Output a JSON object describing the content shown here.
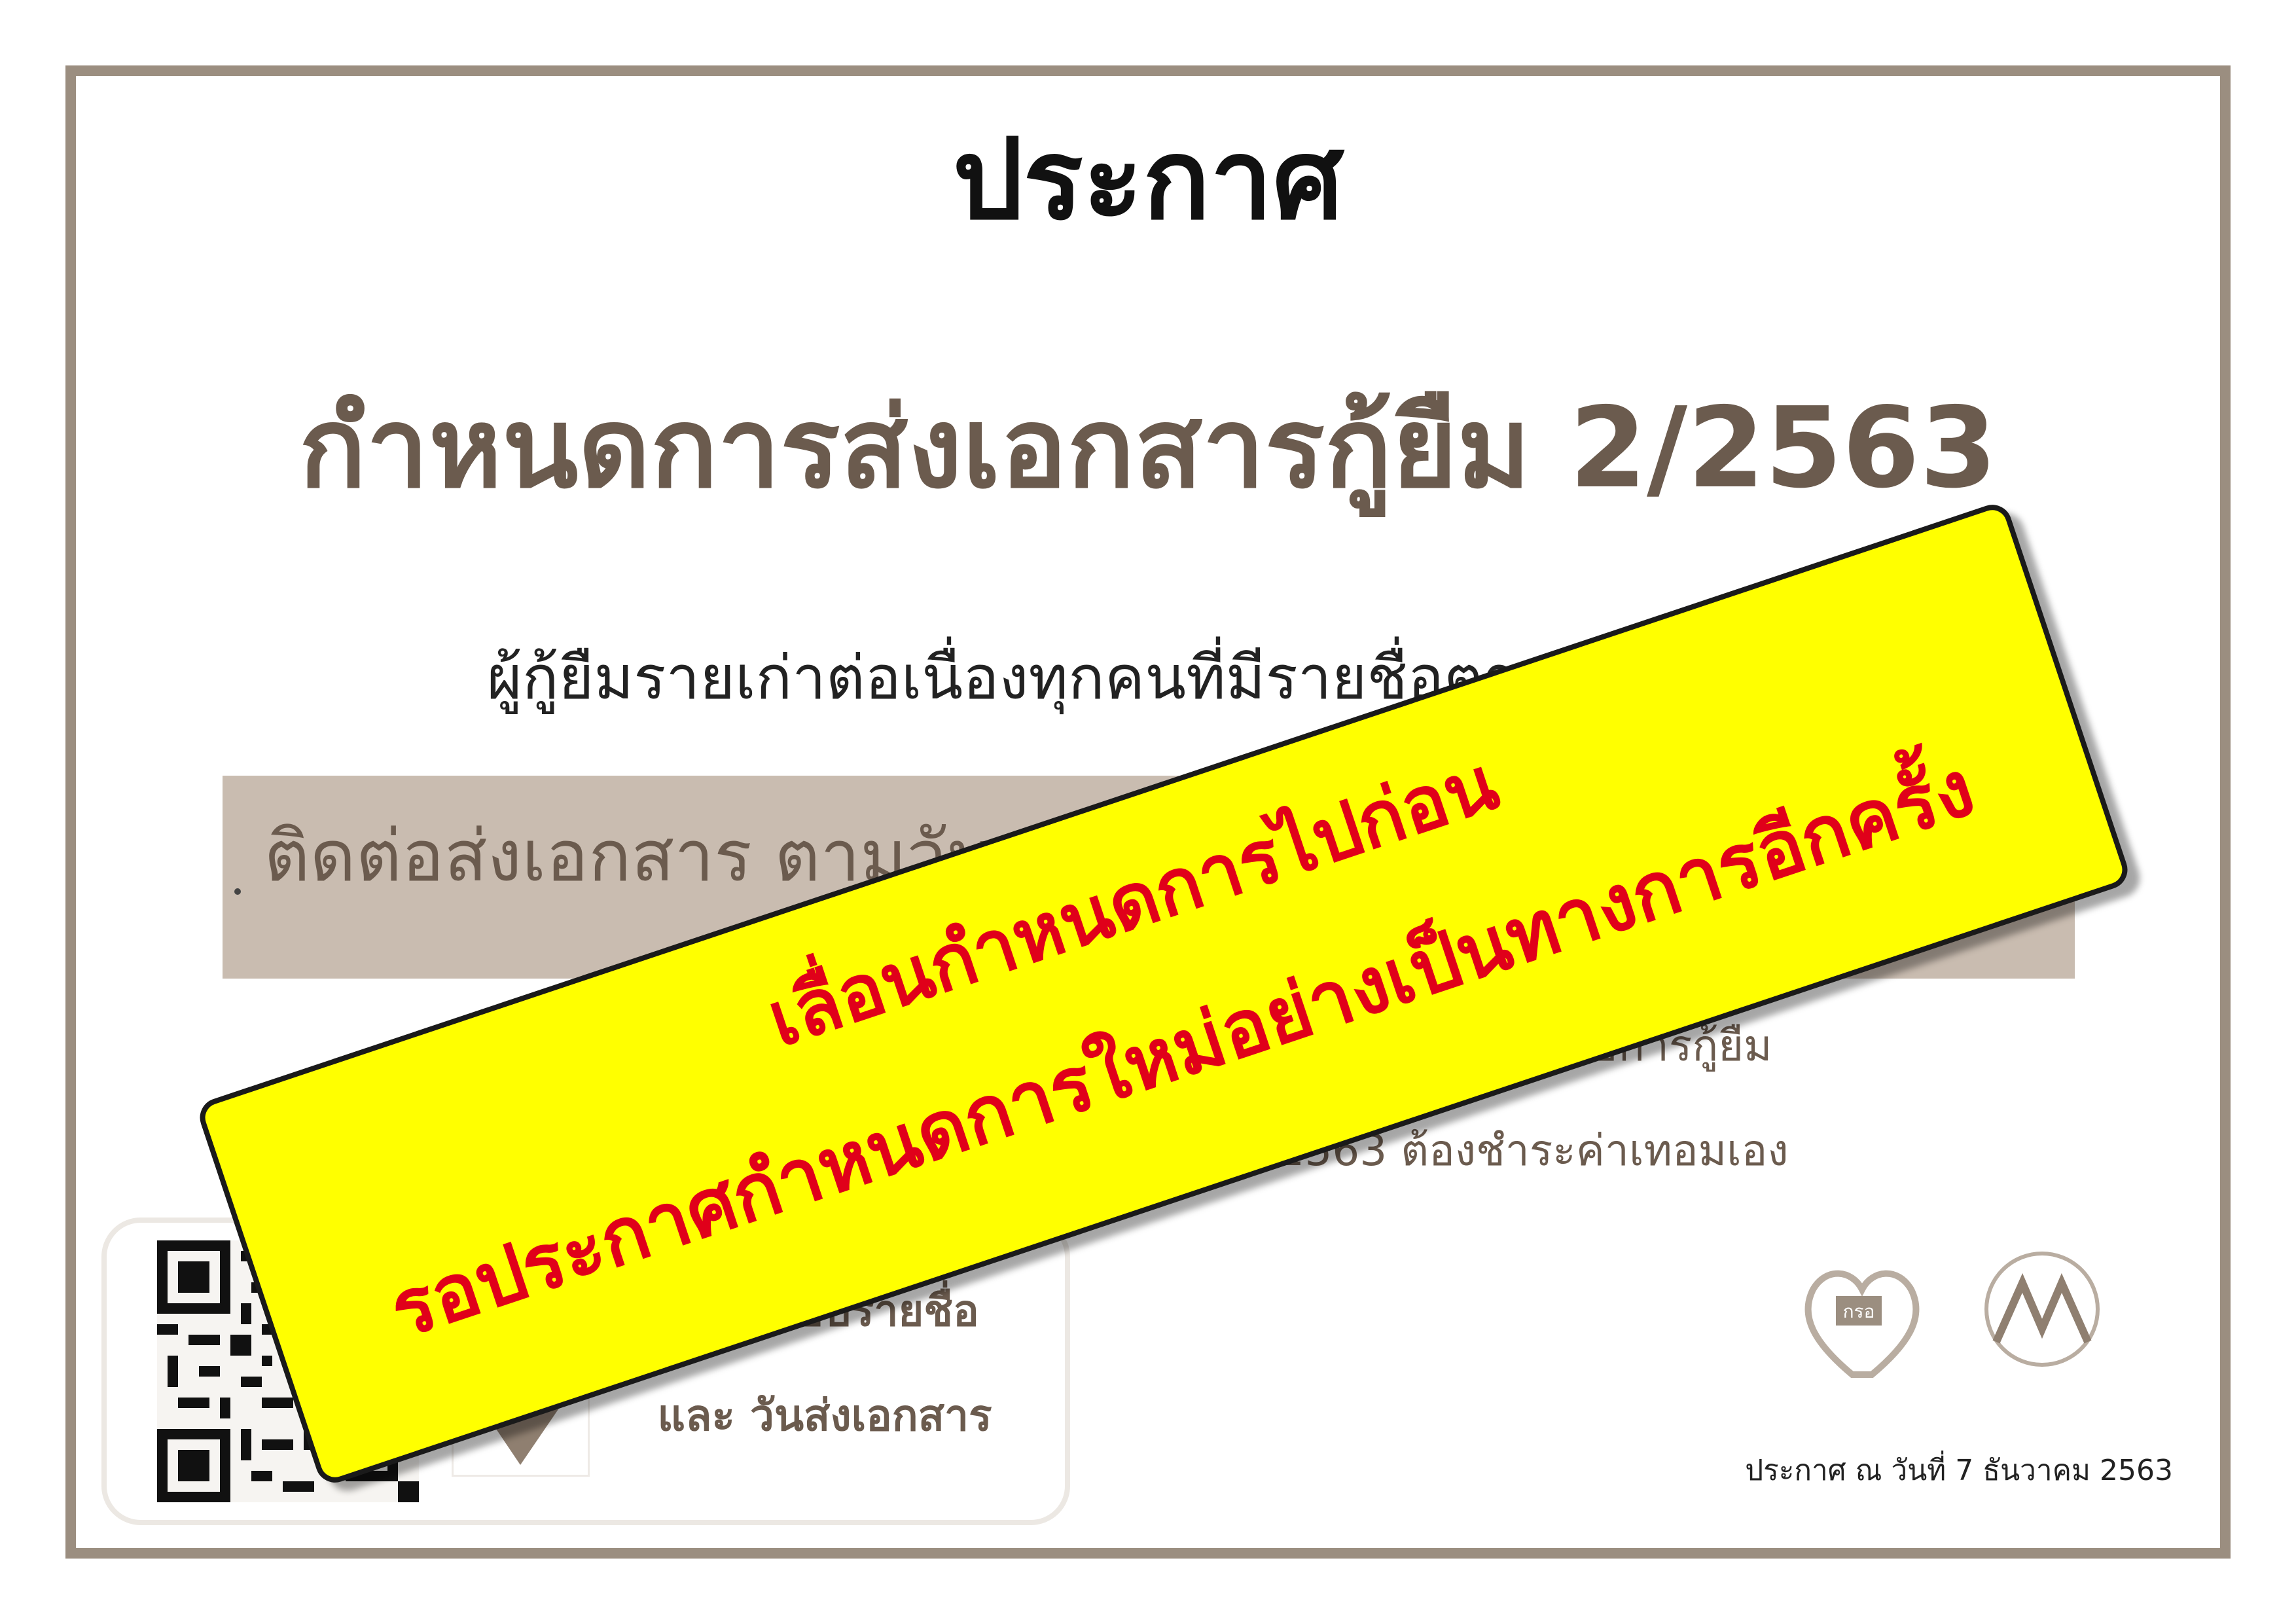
{
  "notice": {
    "title": "ประกาศ",
    "subtitle": "กำหนดการส่งเอกสารกู้ยืม 2/2563",
    "line1": "ผู้กู้ยืมรายเก่าต่อเนื่องทุกคนที่มีรายชื่อตามประกาศนี้",
    "band_text": "ติดต่อส่งเอกสาร ตามวัน เวลา และสถานที่ ที่กำหนดเท่านั้น",
    "note1": "หากไม่มาส่งเอกสารตามวันและเวลาที่กำหนดถือว่าสละสิทธิ์การกู้ยืม",
    "note2": "และจะไม่ได้รับการกู้ยืมเงินเพื่อผู้กู้เทอม 2/2563 ต้องชำระค่าเทอมเอง",
    "date": "ประกาศ ณ วันที่ 7 ธันวาคม 2563"
  },
  "qr_section": {
    "label1": "ตรวจสอบรายชื่อ",
    "label2": "และ วันส่งเอกสาร"
  },
  "banner": {
    "line1": "เลื่อนกำหนดการไปก่อน",
    "line2": "รอประกาศกำหนดการใหม่อย่างเป็นทางการอีกครั้ง"
  },
  "logos": {
    "logo1_text": "กรอ"
  },
  "colors": {
    "frame": "#9b8e80",
    "brown_text": "#6b5b4e",
    "band": "#c9bcb0",
    "banner_bg": "#ffff00",
    "banner_text": "#e0001a"
  }
}
